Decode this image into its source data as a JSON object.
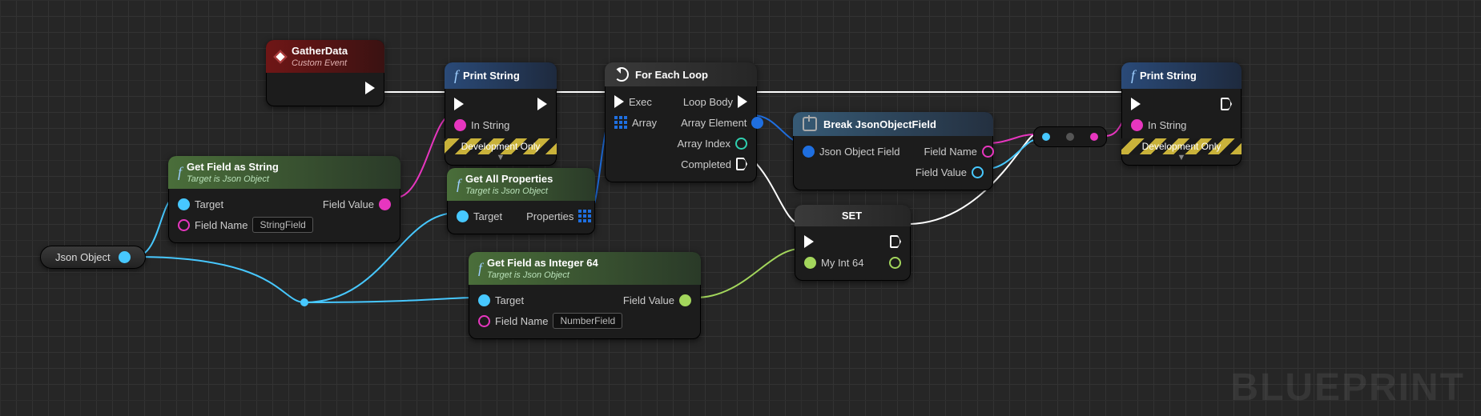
{
  "watermark": "BLUEPRINT",
  "var": {
    "json_object": "Json Object"
  },
  "nodes": {
    "event": {
      "title": "GatherData",
      "sub": "Custom Event"
    },
    "printA": {
      "title": "Print String",
      "in_string": "In String",
      "dev": "Development Only"
    },
    "printB": {
      "title": "Print String",
      "in_string": "In String",
      "dev": "Development Only"
    },
    "getStr": {
      "title": "Get Field as String",
      "sub": "Target is Json Object",
      "target": "Target",
      "fnlabel": "Field Name",
      "fnval": "StringField",
      "out": "Field Value"
    },
    "getProps": {
      "title": "Get All Properties",
      "sub": "Target is Json Object",
      "target": "Target",
      "out": "Properties"
    },
    "getInt": {
      "title": "Get Field as Integer 64",
      "sub": "Target is Json Object",
      "target": "Target",
      "fnlabel": "Field Name",
      "fnval": "NumberField",
      "out": "Field Value"
    },
    "forEach": {
      "title": "For Each Loop",
      "exec": "Exec",
      "array": "Array",
      "loop": "Loop Body",
      "elem": "Array Element",
      "idx": "Array Index",
      "done": "Completed"
    },
    "set": {
      "title": "SET",
      "var": "My Int 64"
    },
    "break": {
      "title": "Break JsonObjectField",
      "in": "Json Object Field",
      "fn": "Field Name",
      "fv": "Field Value"
    }
  }
}
